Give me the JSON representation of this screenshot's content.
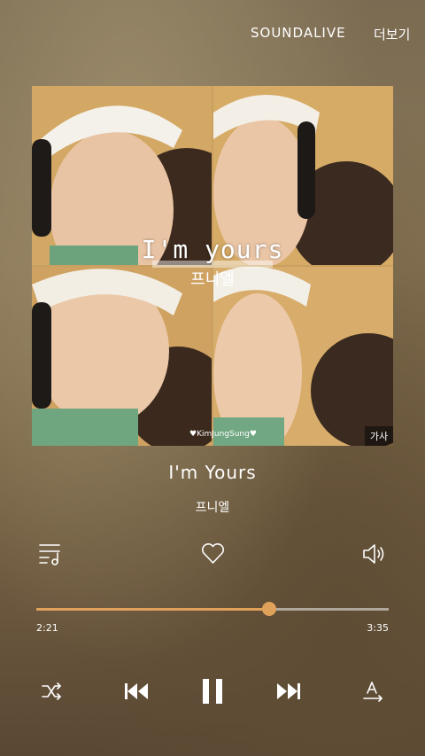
{
  "header": {
    "soundalive": "SOUNDALIVE",
    "more": "더보기"
  },
  "album_art": {
    "overlay_title": "I'm yours",
    "overlay_artist": "프니엘",
    "watermark": "♥KimJungSung♥",
    "lyrics_label": "가사"
  },
  "track": {
    "title": "I'm Yours",
    "artist": "프니엘"
  },
  "progress": {
    "current": "2:21",
    "total": "3:35",
    "fraction": 0.66
  },
  "colors": {
    "accent": "#e0a25a"
  },
  "icons": {
    "playlist": "playlist-icon",
    "favorite": "heart-icon",
    "volume": "volume-icon",
    "shuffle": "shuffle-icon",
    "prev": "previous-icon",
    "play_pause": "pause-icon",
    "next": "next-icon",
    "font": "text-size-icon"
  }
}
